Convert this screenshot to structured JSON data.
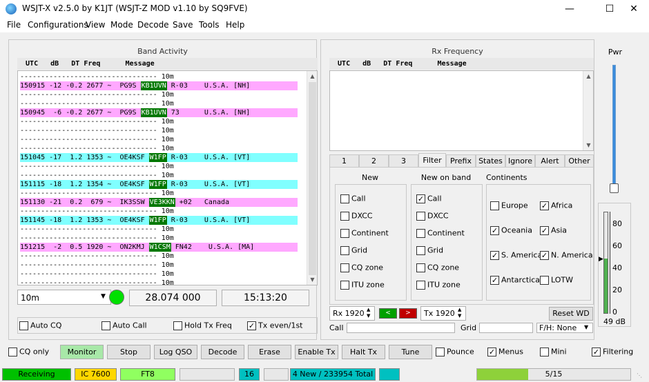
{
  "window": {
    "title": "WSJT-X   v2.5.0    by K1JT (WSJT-Z MOD v1.10 by SQ9FVE)"
  },
  "menu": [
    "File",
    "Configurations",
    "View",
    "Mode",
    "Decode",
    "Save",
    "Tools",
    "Help"
  ],
  "band_activity": {
    "title": "Band Activity",
    "header": "  UTC   dB   DT Freq      Message",
    "lines": [
      {
        "text": "--------------------------------- 10m",
        "bg": ""
      },
      {
        "text": "150915 -12 -0.2 2677 ~  PG9S ",
        "call": "KB1UVN",
        "rest": " R-03    U.S.A. [NH]",
        "bg": "#ffa8ff"
      },
      {
        "text": "--------------------------------- 10m",
        "bg": ""
      },
      {
        "text": "--------------------------------- 10m",
        "bg": ""
      },
      {
        "text": "150945  -6 -0.2 2677 ~  PG9S ",
        "call": "KB1UVN",
        "rest": " 73      U.S.A. [NH]",
        "bg": "#ffa8ff"
      },
      {
        "text": "--------------------------------- 10m",
        "bg": ""
      },
      {
        "text": "--------------------------------- 10m",
        "bg": ""
      },
      {
        "text": "--------------------------------- 10m",
        "bg": ""
      },
      {
        "text": "--------------------------------- 10m",
        "bg": ""
      },
      {
        "text": "151045 -17  1.2 1353 ~  OE4KSF ",
        "call": "W1FP",
        "rest": " R-03    U.S.A. [VT]",
        "bg": "#80ffff"
      },
      {
        "text": "--------------------------------- 10m",
        "bg": ""
      },
      {
        "text": "--------------------------------- 10m",
        "bg": ""
      },
      {
        "text": "151115 -18  1.2 1354 ~  OE4KSF ",
        "call": "W1FP",
        "rest": " R-03    U.S.A. [VT]",
        "bg": "#80ffff"
      },
      {
        "text": "--------------------------------- 10m",
        "bg": ""
      },
      {
        "text": "151130 -21  0.2  679 ~  IK3SSW ",
        "call": "VE3KKN",
        "rest": " +02   Canada",
        "bg": "#ffa8ff"
      },
      {
        "text": "--------------------------------- 10m",
        "bg": ""
      },
      {
        "text": "151145 -18  1.2 1353 ~  OE4KSF ",
        "call": "W1FP",
        "rest": " R-03    U.S.A. [VT]",
        "bg": "#80ffff"
      },
      {
        "text": "--------------------------------- 10m",
        "bg": ""
      },
      {
        "text": "--------------------------------- 10m",
        "bg": ""
      },
      {
        "text": "151215  -2  0.5 1920 ~  ON2KMJ ",
        "call": "W1CSM",
        "rest": " FN42    U.S.A. [MA]",
        "bg": "#ffa8ff"
      },
      {
        "text": "--------------------------------- 10m",
        "bg": ""
      },
      {
        "text": "--------------------------------- 10m",
        "bg": ""
      },
      {
        "text": "--------------------------------- 10m",
        "bg": ""
      },
      {
        "text": "--------------------------------- 10m",
        "bg": ""
      }
    ]
  },
  "rx_frequency": {
    "title": "Rx Frequency",
    "header": "  UTC   dB   DT Freq      Message"
  },
  "band_select": "10m",
  "dial_freq": "28.074 000",
  "utc_time": "15:13:20",
  "checks_left": [
    {
      "label": "Auto CQ",
      "checked": false
    },
    {
      "label": "Auto Call",
      "checked": false
    },
    {
      "label": "Hold Tx Freq",
      "checked": false
    },
    {
      "label": "Tx even/1st",
      "checked": true
    }
  ],
  "tabs": [
    "1",
    "2",
    "3",
    "Filter",
    "Prefix",
    "States",
    "Ignore",
    "Alert",
    "Other"
  ],
  "filter": {
    "new": {
      "title": "New",
      "items": [
        {
          "label": "Call",
          "checked": false
        },
        {
          "label": "DXCC",
          "checked": false
        },
        {
          "label": "Continent",
          "checked": false
        },
        {
          "label": "Grid",
          "checked": false
        },
        {
          "label": "CQ zone",
          "checked": false
        },
        {
          "label": "ITU zone",
          "checked": false
        }
      ]
    },
    "new_on_band": {
      "title": "New on band",
      "items": [
        {
          "label": "Call",
          "checked": true
        },
        {
          "label": "DXCC",
          "checked": false
        },
        {
          "label": "Continent",
          "checked": false
        },
        {
          "label": "Grid",
          "checked": false
        },
        {
          "label": "CQ zone",
          "checked": false
        },
        {
          "label": "ITU zone",
          "checked": false
        }
      ]
    },
    "continents": {
      "title": "Continents",
      "items": [
        {
          "label": "Europe",
          "checked": false
        },
        {
          "label": "Africa",
          "checked": true
        },
        {
          "label": "Oceania",
          "checked": true
        },
        {
          "label": "Asia",
          "checked": true
        },
        {
          "label": "S. America",
          "checked": true
        },
        {
          "label": "N. America",
          "checked": true
        },
        {
          "label": "Antarctica",
          "checked": true
        },
        {
          "label": "LOTW",
          "checked": false
        }
      ]
    }
  },
  "rx_spin": "Rx 1920",
  "tx_spin": "Tx 1920",
  "reset_wd": "Reset WD",
  "call_label": "Call",
  "grid_label": "Grid",
  "fh_select": "F/H: None",
  "pwr_label": "Pwr",
  "meter": {
    "ticks": [
      "80",
      "60",
      "40",
      "20",
      "0"
    ],
    "db": "49 dB",
    "level_db": 49
  },
  "bottom_buttons": {
    "cq_only": "CQ only",
    "monitor": "Monitor",
    "stop": "Stop",
    "log_qso": "Log QSO",
    "decode": "Decode",
    "erase": "Erase",
    "enable_tx": "Enable Tx",
    "halt_tx": "Halt Tx",
    "tune": "Tune",
    "pounce": "Pounce",
    "menus": "Menus",
    "mini": "Mini",
    "filtering": "Filtering"
  },
  "status": {
    "receiving": "Receiving",
    "rig": "IC 7600",
    "mode": "FT8",
    "count": "16",
    "decodes": "4 New / 233954 Total",
    "progress": "5/15",
    "progress_fraction": 0.333
  },
  "colors": {
    "receiving": "#00c000",
    "rig": "#ffd700",
    "mode": "#90ff60",
    "teal": "#00c0c0",
    "call_hl": "#007800"
  }
}
